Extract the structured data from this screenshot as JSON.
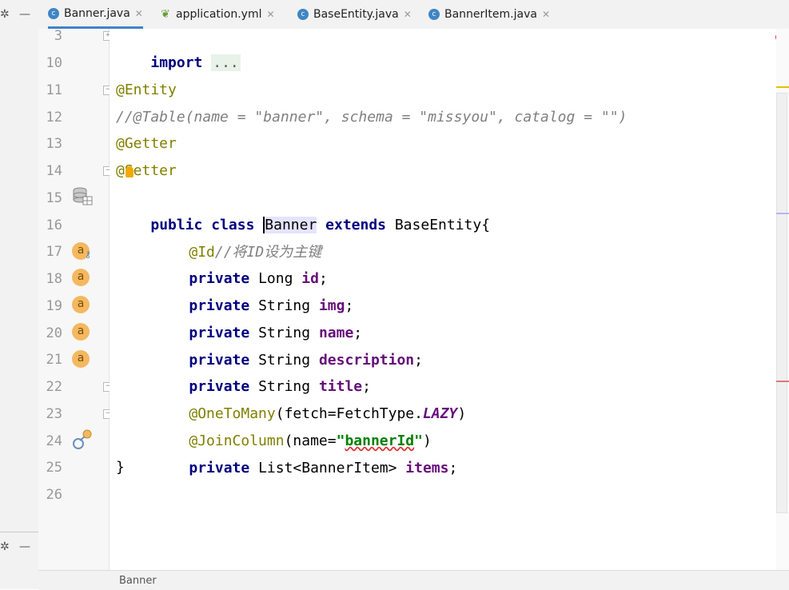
{
  "tabs": [
    {
      "label": "Banner.java",
      "icon": "class-icon",
      "active": true
    },
    {
      "label": "application.yml",
      "icon": "spring-leaf-icon",
      "active": false
    },
    {
      "label": "BaseEntity.java",
      "icon": "class-icon",
      "active": false
    },
    {
      "label": "BannerItem.java",
      "icon": "class-icon",
      "active": false
    }
  ],
  "line_numbers": [
    "3",
    "10",
    "11",
    "12",
    "13",
    "14",
    "15",
    "16",
    "17",
    "18",
    "19",
    "20",
    "21",
    "22",
    "23",
    "24",
    "25",
    "26"
  ],
  "code": {
    "l3_import": "import",
    "l3_fold": "...",
    "l11": "@Entity",
    "l12": "//@Table(name = \"banner\", schema = \"missyou\", catalog = \"\")",
    "l13": "@Getter",
    "l14": "@Setter",
    "l15_public": "public",
    "l15_class": "class",
    "l15_name": "Banner",
    "l15_extends": "extends",
    "l15_rest": "BaseEntity{",
    "l16_ann": "@Id",
    "l16_comment": "//将ID设为主键",
    "l17": {
      "kw": "private",
      "type": "Long",
      "name": "id",
      "end": ";"
    },
    "l18": {
      "kw": "private",
      "type": "String",
      "name": "img",
      "end": ";"
    },
    "l19": {
      "kw": "private",
      "type": "String",
      "name": "name",
      "end": ";"
    },
    "l20": {
      "kw": "private",
      "type": "String",
      "name": "description",
      "end": ";"
    },
    "l21": {
      "kw": "private",
      "type": "String",
      "name": "title",
      "end": ";"
    },
    "l22_ann": "@OneToMany",
    "l22_open": "(fetch=FetchType.",
    "l22_const": "LAZY",
    "l22_close": ")",
    "l23_ann": "@JoinColumn",
    "l23_open": "(name=",
    "l23_str_q1": "\"",
    "l23_str": "bannerId",
    "l23_str_q2": "\"",
    "l23_close": ")",
    "l24": {
      "kw": "private",
      "type": "List<BannerItem>",
      "name": "items",
      "end": ";"
    },
    "l25": "}"
  },
  "gutter_icons": {
    "field": "a",
    "entity": "database-icon",
    "relation": "link-icon"
  },
  "breadcrumb": "Banner",
  "colors": {
    "keyword": "#000080",
    "annotation": "#808000",
    "comment": "#808080",
    "field": "#660e7a",
    "string": "#008000"
  }
}
